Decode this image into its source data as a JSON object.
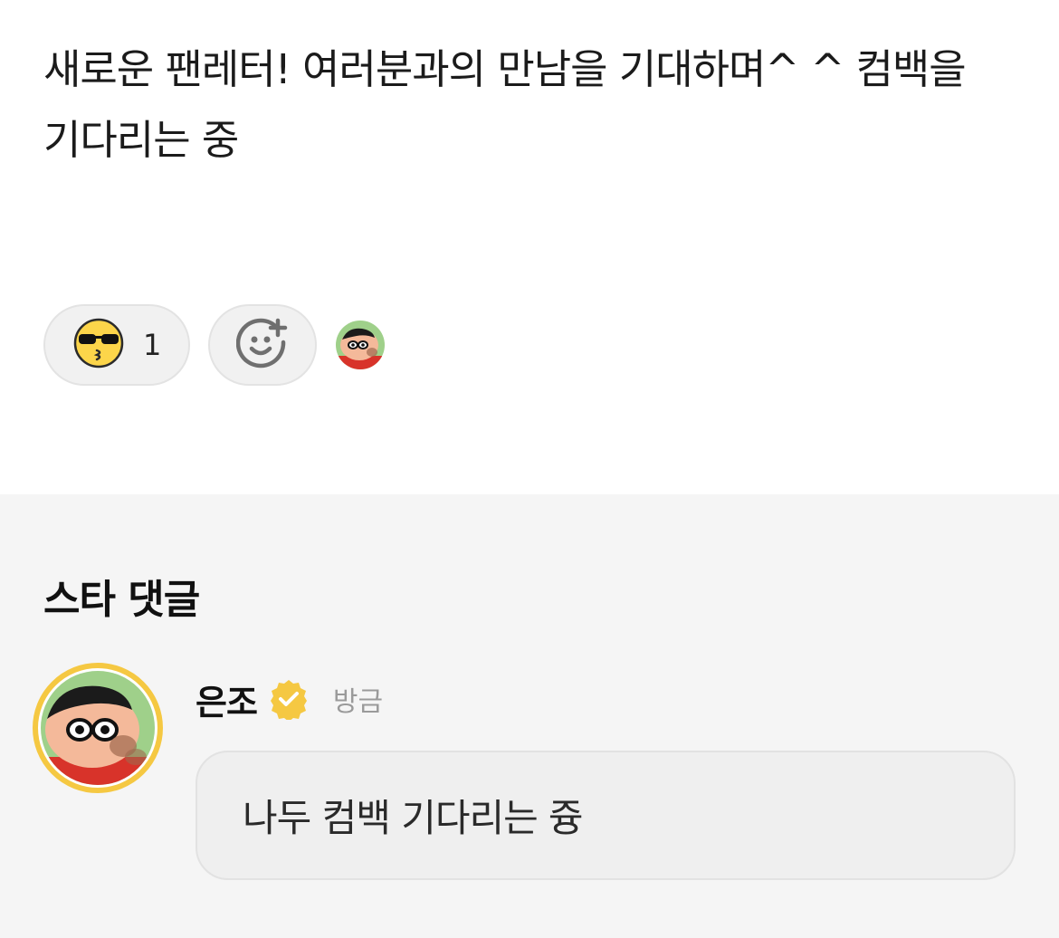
{
  "post": {
    "text": "새로운 팬레터! 여러분과의 만남을 기대하며^ ^ 컴백을 기다리는 중"
  },
  "reactions": {
    "emoji_icon": "sunglasses-kiss-emoji-icon",
    "count": "1",
    "add_icon": "add-reaction-icon",
    "reactor_avatar": "crayon-shin-chan-avatar"
  },
  "comments": {
    "title": "스타 댓글",
    "items": [
      {
        "author": "은조",
        "verified_icon": "verified-badge-icon",
        "time": "방금",
        "text": "나두 컴백 기다리는 즁",
        "avatar": "crayon-shin-chan-avatar"
      }
    ]
  },
  "colors": {
    "background": "#ffffff",
    "comments_background": "#f5f5f5",
    "pill_background": "#f1f1f1",
    "verified": "#f5c842",
    "avatar_ring": "#f5c842",
    "time_text": "#9a9a9a"
  }
}
